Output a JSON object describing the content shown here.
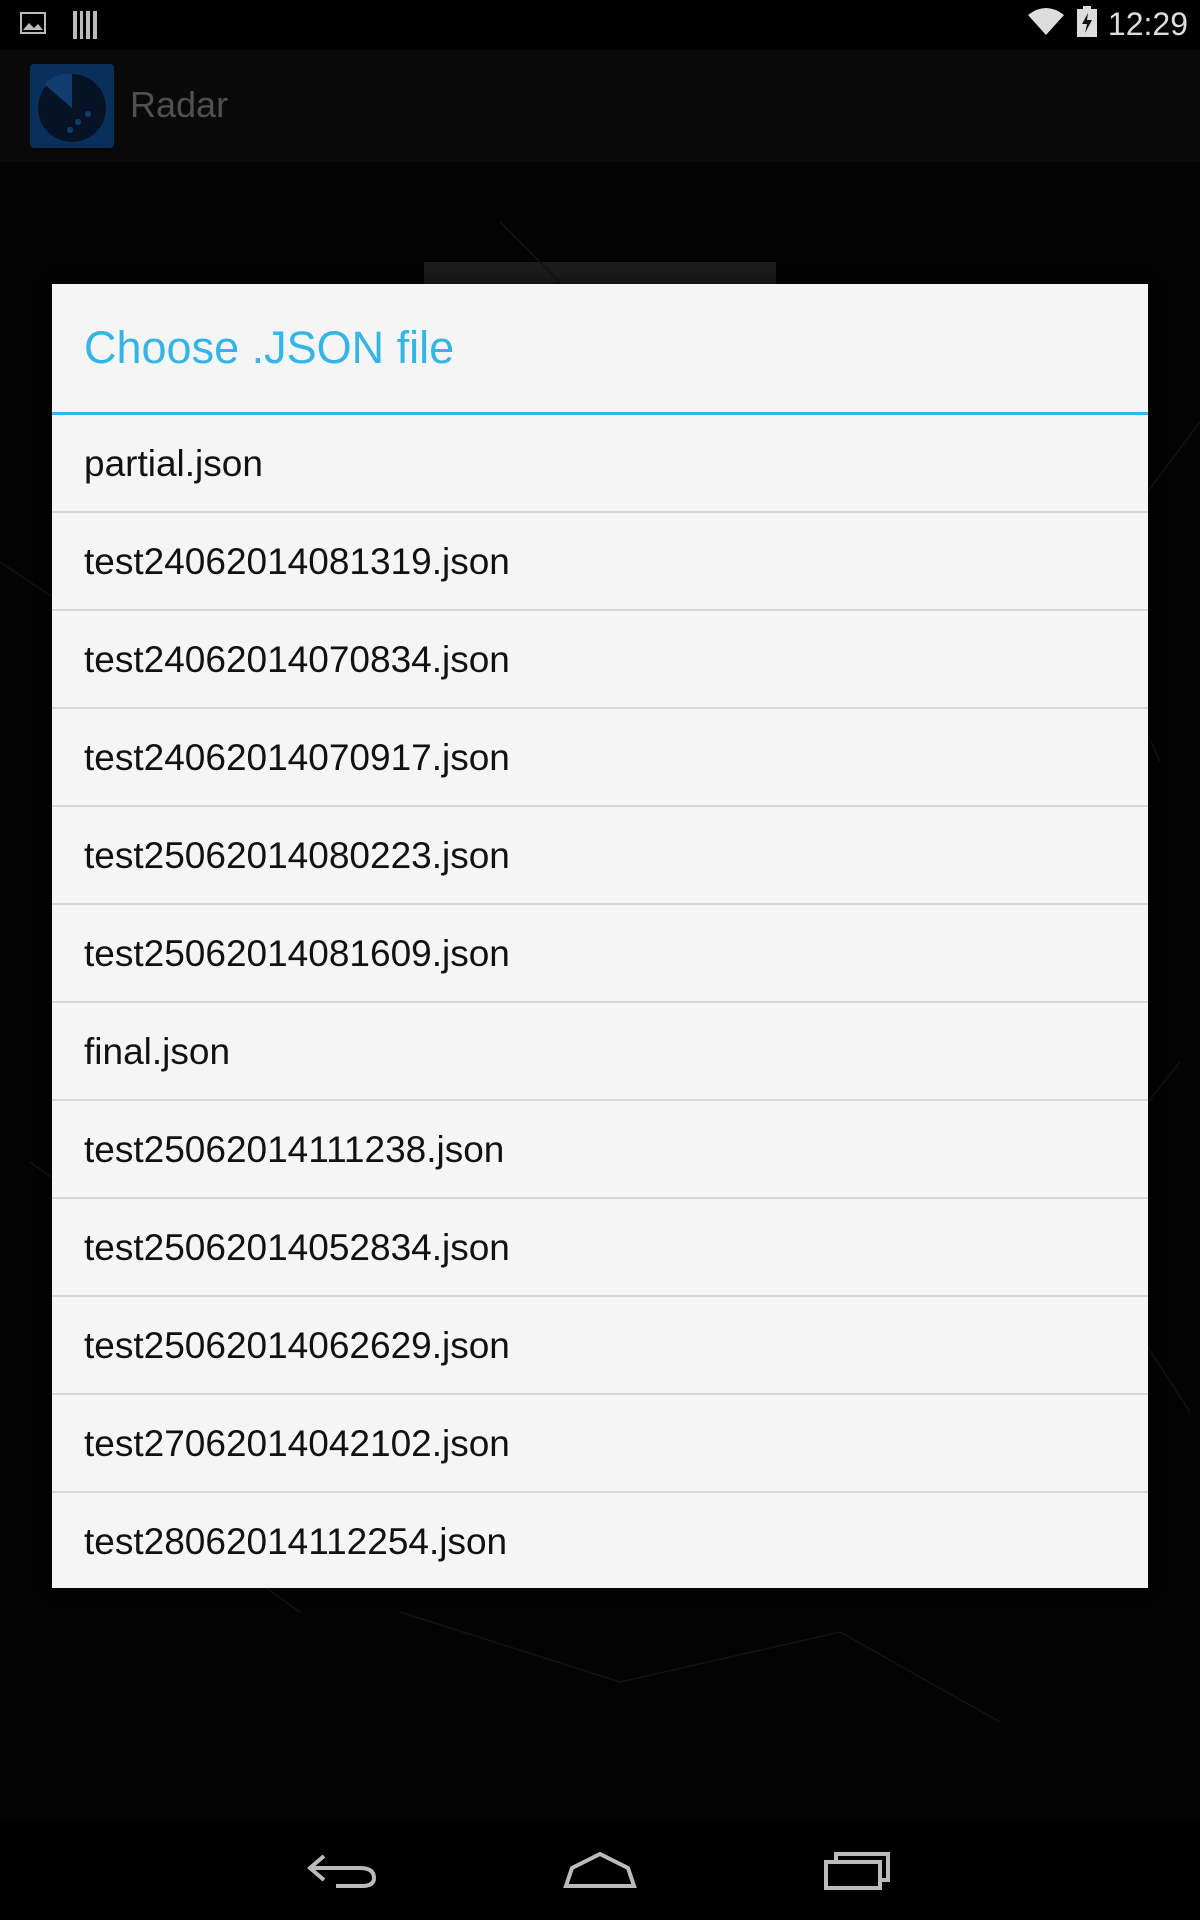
{
  "status_bar": {
    "time": "12:29",
    "left_icons": [
      "image-notification-icon",
      "barcode-notification-icon"
    ],
    "right_icons": [
      "wifi-icon",
      "battery-charging-icon"
    ]
  },
  "action_bar": {
    "title": "Radar",
    "icon": "radar-app-icon"
  },
  "dialog": {
    "title": "Choose .JSON file",
    "accent_color": "#33b5e5",
    "files": [
      "partial.json",
      "test24062014081319.json",
      "test24062014070834.json",
      "test24062014070917.json",
      "test25062014080223.json",
      "test25062014081609.json",
      "final.json",
      "test25062014111238.json",
      "test25062014052834.json",
      "test25062014062629.json",
      "test27062014042102.json",
      "test28062014112254.json"
    ]
  },
  "nav_bar": {
    "buttons": [
      "back-icon",
      "home-icon",
      "recent-apps-icon"
    ]
  }
}
